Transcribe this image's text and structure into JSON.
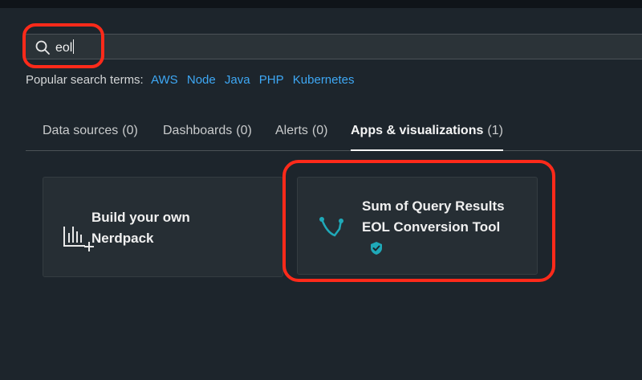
{
  "search": {
    "value": "eol"
  },
  "popular": {
    "label": "Popular search terms:",
    "terms": [
      "AWS",
      "Node",
      "Java",
      "PHP",
      "Kubernetes"
    ]
  },
  "tabs": [
    {
      "label": "Data sources",
      "count": "(0)"
    },
    {
      "label": "Dashboards",
      "count": "(0)"
    },
    {
      "label": "Alerts",
      "count": "(0)"
    },
    {
      "label": "Apps & visualizations",
      "count": "(1)",
      "active": true
    }
  ],
  "cards": [
    {
      "title": "Build your own Nerdpack",
      "icon": "nerdpack-chart-icon"
    },
    {
      "title": "Sum of Query Results EOL Conversion Tool",
      "icon": "app-branch-icon",
      "badge": "verified-shield-icon"
    }
  ],
  "colors": {
    "background": "#1d252c",
    "link": "#3ea8f5",
    "highlight": "#ff2a1a",
    "teal": "#1fa9b8"
  }
}
